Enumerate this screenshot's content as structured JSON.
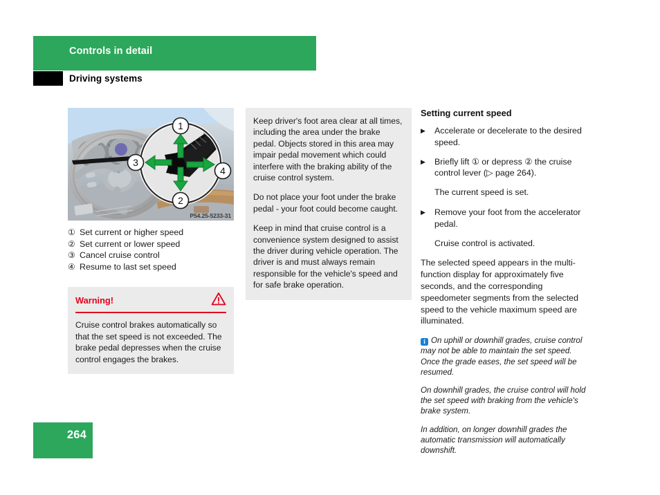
{
  "header": {
    "chapter": "Controls in detail",
    "section": "Driving systems"
  },
  "figure": {
    "code": "P54.25-5233-31",
    "alt": "Steering wheel with magnified view of cruise control lever and four directional green arrows",
    "callouts": [
      "1",
      "2",
      "3",
      "4"
    ]
  },
  "legend": [
    {
      "num": "①",
      "text": "Set current or higher speed"
    },
    {
      "num": "②",
      "text": "Set current or lower speed"
    },
    {
      "num": "③",
      "text": "Cancel cruise control"
    },
    {
      "num": "④",
      "text": "Resume to last set speed"
    }
  ],
  "warning": {
    "title": "Warning!",
    "icon": "warning-triangle-icon",
    "body": "Cruise control brakes automatically so that the set speed is not exceeded. The brake pedal depresses when the cruise control engages the brakes."
  },
  "gray_note": {
    "paragraphs": [
      "Keep driver's foot area clear at all times, including the area under the brake pedal. Objects stored in this area may impair pedal movement which could interfere with the braking ability of the cruise control system.",
      "Do not place your foot under the brake pedal - your foot could become caught.",
      "Keep in mind that cruise control is a convenience system designed to assist the driver during vehicle operation. The driver is and must always remain responsible for the vehicle's speed and for safe brake operation."
    ]
  },
  "right": {
    "heading": "Setting current speed",
    "bullet_mark": "▶",
    "steps": [
      {
        "text": "Accelerate or decelerate to the desired speed."
      },
      {
        "text": "Briefly lift ① or depress ② the cruise control lever (▷ page 264)."
      }
    ],
    "result1": "The current speed is set.",
    "step3": "Remove your foot from the accelerator pedal.",
    "result2": "Cruise control is activated.",
    "paragraph": "The selected speed appears in the multi-function display for approximately five seconds, and the corresponding speedometer segments from the selected speed to the vehicle maximum speed are illuminated.",
    "info": {
      "icon_letter": "i",
      "paragraphs": [
        "On uphill or downhill grades, cruise control may not be able to maintain the set speed. Once the grade eases, the set speed will be resumed.",
        "On downhill grades, the cruise control will hold the set speed with braking from the vehicle's brake system.",
        "In addition, on longer downhill grades the automatic transmission will automatically downshift."
      ]
    }
  },
  "footer": {
    "page": "264"
  },
  "colors": {
    "brand_green": "#2da75b",
    "warning_red": "#e2001a",
    "info_blue": "#1b7fd4",
    "box_gray": "#ebebeb"
  }
}
